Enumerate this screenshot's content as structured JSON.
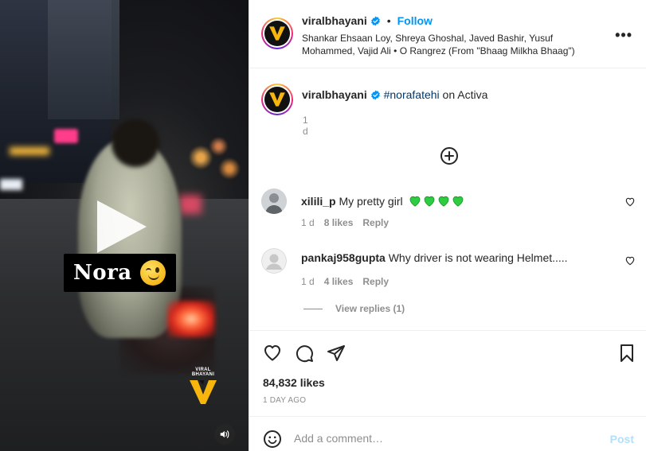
{
  "video": {
    "caption_overlay": "Nora",
    "watermark": "VIRAL BHAYANI",
    "icons": {
      "play": "play-icon",
      "sound": "speaker-icon",
      "emoji": "winking-face-emoji"
    }
  },
  "header": {
    "username": "viralbhayani",
    "separator": "•",
    "follow_label": "Follow",
    "audio": "Shankar Ehsaan Loy, Shreya Ghoshal, Javed Bashir, Yusuf Mohammed, Vajid Ali • O Rangrez (From \"Bhaag Milkha Bhaag\")",
    "more_label": "•••"
  },
  "caption": {
    "username": "viralbhayani",
    "hashtag": "#norafatehi",
    "text": " on Activa",
    "time": "1 d"
  },
  "comments": [
    {
      "username": "xilili_p",
      "text": "My pretty girl",
      "emoji": "green-heart x4",
      "time": "1 d",
      "likes": "8 likes",
      "reply_label": "Reply"
    },
    {
      "username": "pankaj958gupta",
      "text": "Why driver is not wearing Helmet.....",
      "time": "1 d",
      "likes": "4 likes",
      "reply_label": "Reply",
      "view_replies": "View replies (1)"
    }
  ],
  "post": {
    "likes": "84,832 likes",
    "time_ago": "1 DAY AGO"
  },
  "add_comment": {
    "placeholder": "Add a comment…",
    "post_label": "Post"
  },
  "colors": {
    "accent_blue": "#0095f6",
    "post_disabled": "#b2dffc",
    "hashtag": "#00376b",
    "muted": "#8e8e8e",
    "heart_green": "#2ecc40"
  }
}
